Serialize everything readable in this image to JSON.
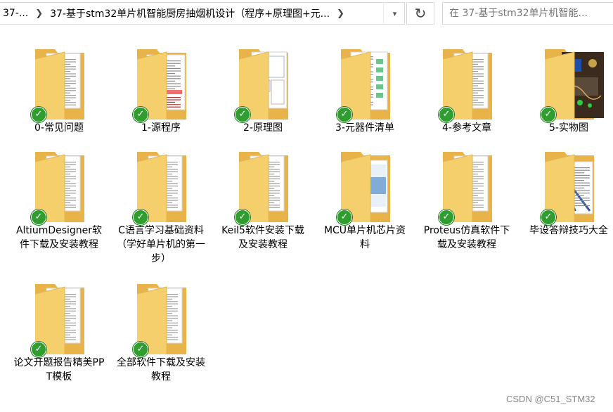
{
  "address_bar": {
    "crumbs": [
      "37-...",
      "37-基于stm32单片机智能厨房抽烟机设计（程序+原理图+元..."
    ],
    "search_placeholder": "在 37-基于stm32单片机智能..."
  },
  "folders": [
    {
      "name": "0-常见问题",
      "preview": "doc"
    },
    {
      "name": "1-源程序",
      "preview": "code"
    },
    {
      "name": "2-原理图",
      "preview": "schematic"
    },
    {
      "name": "3-元器件清单",
      "preview": "bom"
    },
    {
      "name": "4-参考文章",
      "preview": "doc"
    },
    {
      "name": "5-实物图",
      "preview": "photo"
    },
    {
      "name": "AltiumDesigner软件下载及安装教程",
      "preview": "doc"
    },
    {
      "name": "C语言学习基础资料（学好单片机的第一步）",
      "preview": "doc"
    },
    {
      "name": "Keil5软件安装下载及安装教程",
      "preview": "doc"
    },
    {
      "name": "MCU单片机芯片资料",
      "preview": "datasheet"
    },
    {
      "name": "Proteus仿真软件下载及安装教程",
      "preview": "doc"
    },
    {
      "name": "毕设答辩技巧大全",
      "preview": "slides"
    },
    {
      "name": "论文开题报告精美PPT模板",
      "preview": "doc"
    },
    {
      "name": "全部软件下载及安装教程",
      "preview": "doc"
    }
  ],
  "watermark": "CSDN @C51_STM32"
}
